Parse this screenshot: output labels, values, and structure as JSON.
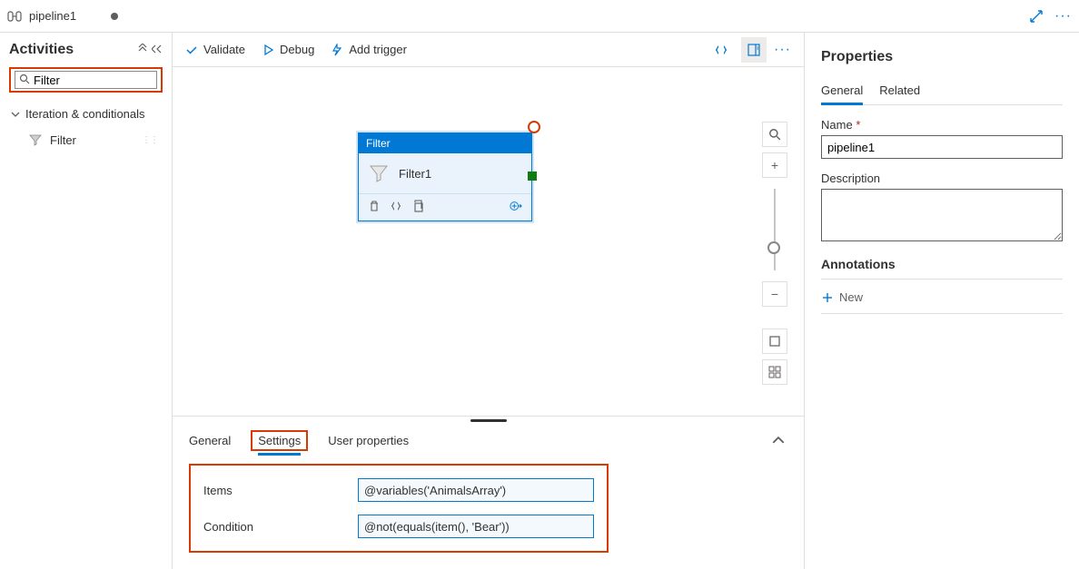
{
  "topbar": {
    "title": "pipeline1"
  },
  "sidebar": {
    "title": "Activities",
    "search_value": "Filter",
    "category": "Iteration & conditionals",
    "items": [
      {
        "label": "Filter"
      }
    ]
  },
  "toolbar": {
    "validate": "Validate",
    "debug": "Debug",
    "add_trigger": "Add trigger"
  },
  "canvas": {
    "node": {
      "type_label": "Filter",
      "name": "Filter1"
    }
  },
  "bottom": {
    "tabs": {
      "general": "General",
      "settings": "Settings",
      "user_properties": "User properties"
    },
    "settings": {
      "items_label": "Items",
      "items_value": "@variables('AnimalsArray')",
      "condition_label": "Condition",
      "condition_value": "@not(equals(item(), 'Bear'))"
    }
  },
  "properties": {
    "title": "Properties",
    "tabs": {
      "general": "General",
      "related": "Related"
    },
    "name_label": "Name",
    "name_value": "pipeline1",
    "description_label": "Description",
    "description_value": "",
    "annotations_label": "Annotations",
    "new_label": "New"
  }
}
